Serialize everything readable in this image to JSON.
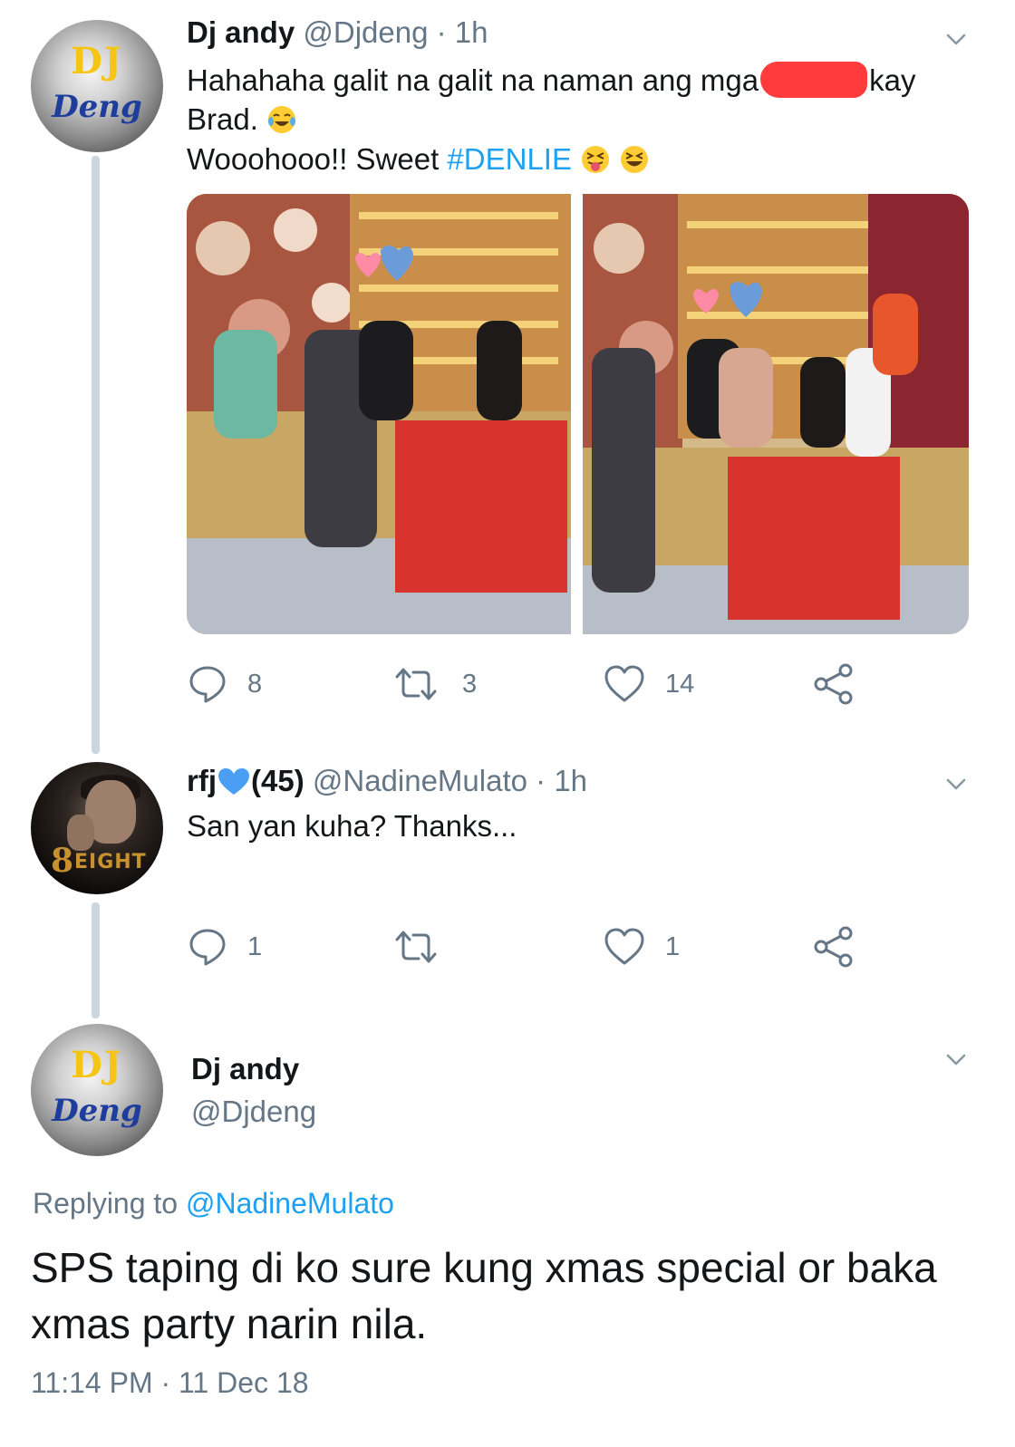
{
  "tweets": [
    {
      "avatar": {
        "line1": "DJ",
        "line2": "Deng"
      },
      "display_name": "Dj andy",
      "handle": "@Djdeng",
      "time": "1h",
      "text_line1_a": "Hahahaha galit na galit na naman ang mga",
      "text_line1_b": "kay",
      "text_line2": "Brad.",
      "text_line3_a": "Wooohooo!! Sweet ",
      "hashtag": "#DENLIE",
      "actions": {
        "replies": "8",
        "retweets": "3",
        "likes": "14"
      }
    },
    {
      "avatar": {
        "logo": "8",
        "logo_text": "EIGHT"
      },
      "display_name": "rfj",
      "display_name_suffix": "(45)",
      "handle": "@NadineMulato",
      "time": "1h",
      "text": "San yan kuha? Thanks...",
      "actions": {
        "replies": "1",
        "retweets": "",
        "likes": "1"
      }
    }
  ],
  "focused_tweet": {
    "avatar": {
      "line1": "DJ",
      "line2": "Deng"
    },
    "display_name": "Dj andy",
    "handle": "@Djdeng",
    "replying_to_label": "Replying to ",
    "replying_to_handle": "@NadineMulato",
    "text": "SPS taping di ko sure kung xmas special or baka xmas party narin nila.",
    "timestamp": "11:14 PM · 11 Dec 18"
  },
  "colors": {
    "link": "#1da1f2",
    "muted": "#657786",
    "text": "#14171a",
    "thread_line": "#ccd6dd"
  }
}
